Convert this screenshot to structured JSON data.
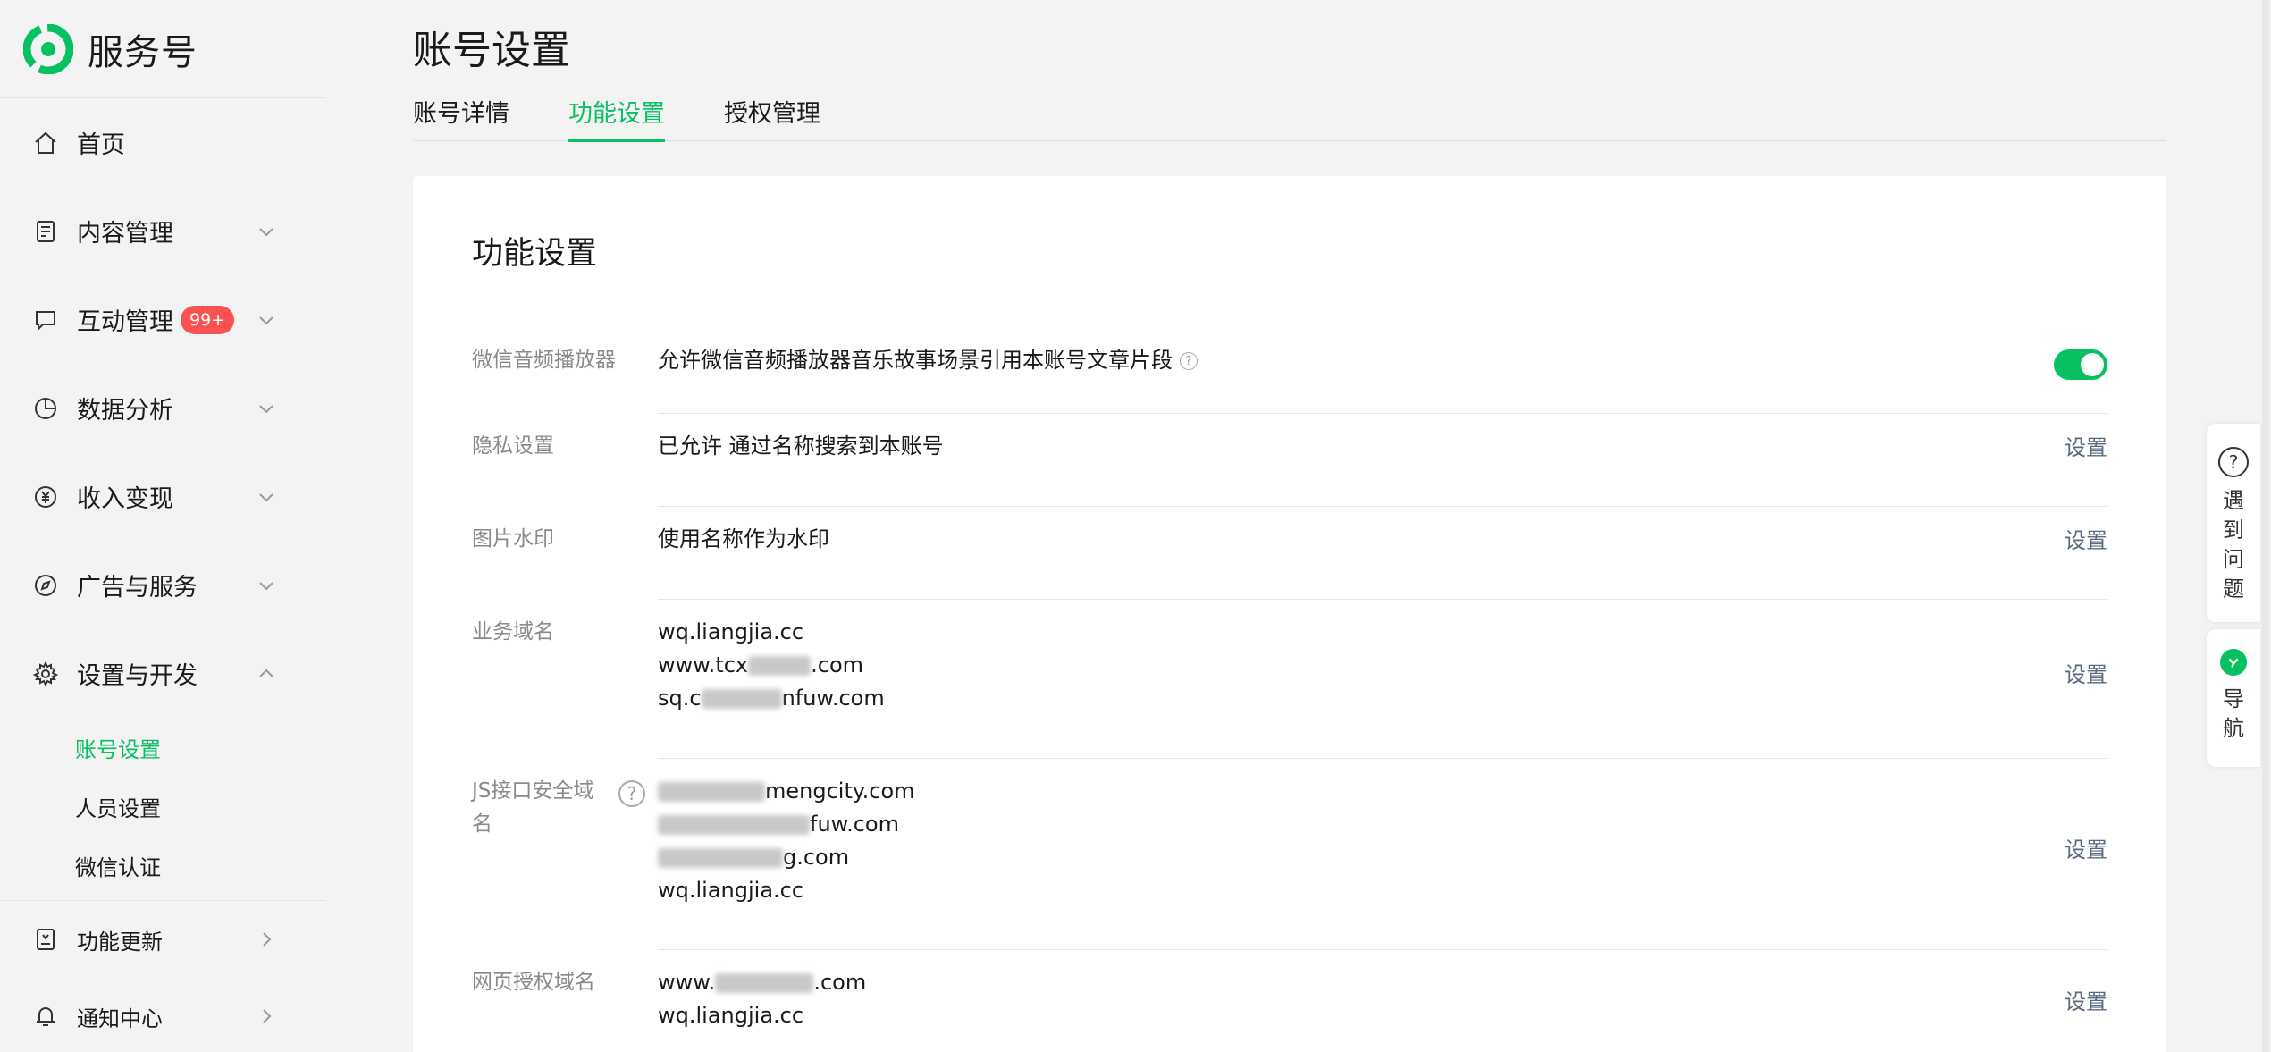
{
  "brand": {
    "name": "服务号"
  },
  "sidebar": {
    "items": [
      {
        "label": "首页"
      },
      {
        "label": "内容管理"
      },
      {
        "label": "互动管理",
        "badge": "99+"
      },
      {
        "label": "数据分析"
      },
      {
        "label": "收入变现"
      },
      {
        "label": "广告与服务"
      },
      {
        "label": "设置与开发"
      }
    ],
    "subitems": [
      {
        "label": "账号设置"
      },
      {
        "label": "人员设置"
      },
      {
        "label": "微信认证"
      }
    ],
    "bottom": [
      {
        "label": "功能更新"
      },
      {
        "label": "通知中心"
      }
    ]
  },
  "page": {
    "title": "账号设置",
    "tabs": [
      "账号详情",
      "功能设置",
      "授权管理"
    ]
  },
  "card": {
    "title": "功能设置",
    "rows": [
      {
        "label": "微信音频播放器",
        "value": "允许微信音频播放器音乐故事场景引用本账号文章片段"
      },
      {
        "label": "隐私设置",
        "value": "已允许 通过名称搜索到本账号",
        "action": "设置"
      },
      {
        "label": "图片水印",
        "value": "使用名称作为水印",
        "action": "设置"
      },
      {
        "label": "业务域名",
        "lines": [
          "wq.liangjia.cc",
          "www.tcx",
          ".com",
          "sq.c",
          "nfuw.com"
        ],
        "action": "设置"
      },
      {
        "label": "JS接口安全域名",
        "lines": [
          "mengcity.com",
          "fuw.com",
          "g.com",
          "wq.liangjia.cc"
        ],
        "action": "设置"
      },
      {
        "label": "网页授权域名",
        "lines": [
          "www.",
          ".com",
          "wq.liangjia.cc"
        ],
        "action": "设置"
      }
    ]
  },
  "float": {
    "help": "遇到问题",
    "nav": "导航"
  },
  "colors": {
    "accent": "#07c160",
    "badge": "#fa5151"
  }
}
